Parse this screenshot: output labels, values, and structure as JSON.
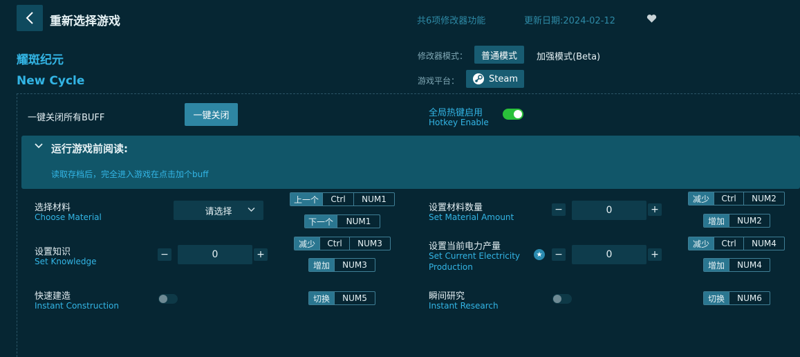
{
  "header": {
    "title": "重新选择游戏",
    "feature_count": "共6项修改器功能",
    "update_date": "更新日期:2024-02-12"
  },
  "game": {
    "name_cn": "耀斑纪元",
    "name_en": "New Cycle"
  },
  "mode": {
    "label": "修改器模式：",
    "normal": "普通模式",
    "enhanced": "加强模式(Beta)"
  },
  "platform": {
    "label": "游戏平台：",
    "name": "Steam"
  },
  "global": {
    "close_all_label": "一键关闭所有BUFF",
    "close_all_button": "一键关闭",
    "hotkey_cn": "全局热键启用",
    "hotkey_en": "Hotkey Enable"
  },
  "notice": {
    "title": "运行游戏前阅读:",
    "text": "读取存档后，完全进入游戏在点击加个buff"
  },
  "features": {
    "material": {
      "cn": "选择材料",
      "en": "Choose Material",
      "select": "请选择",
      "prev_tag": "上一个",
      "prev_mod": "Ctrl",
      "prev_key": "NUM1",
      "next_tag": "下一个",
      "next_key": "NUM1"
    },
    "material_qty": {
      "cn": "设置材料数量",
      "en": "Set Material Amount",
      "value": "0",
      "dec_tag": "减少",
      "dec_mod": "Ctrl",
      "dec_key": "NUM2",
      "inc_tag": "增加",
      "inc_key": "NUM2"
    },
    "knowledge": {
      "cn": "设置知识",
      "en": "Set Knowledge",
      "value": "0",
      "dec_tag": "减少",
      "dec_mod": "Ctrl",
      "dec_key": "NUM3",
      "inc_tag": "增加",
      "inc_key": "NUM3"
    },
    "electricity": {
      "cn": "设置当前电力产量",
      "en_line1": "Set Current Electricity",
      "en_line2": "Production",
      "value": "0",
      "dec_tag": "减少",
      "dec_mod": "Ctrl",
      "dec_key": "NUM4",
      "inc_tag": "增加",
      "inc_key": "NUM4"
    },
    "instant_build": {
      "cn": "快速建造",
      "en": "Instant Construction",
      "tag": "切换",
      "key": "NUM5"
    },
    "instant_research": {
      "cn": "瞬间研究",
      "en": "Instant Research",
      "tag": "切换",
      "key": "NUM6"
    }
  },
  "colors": {
    "background": "#062633",
    "accent": "#33b5e5",
    "toggle_on": "#2ac03a"
  }
}
